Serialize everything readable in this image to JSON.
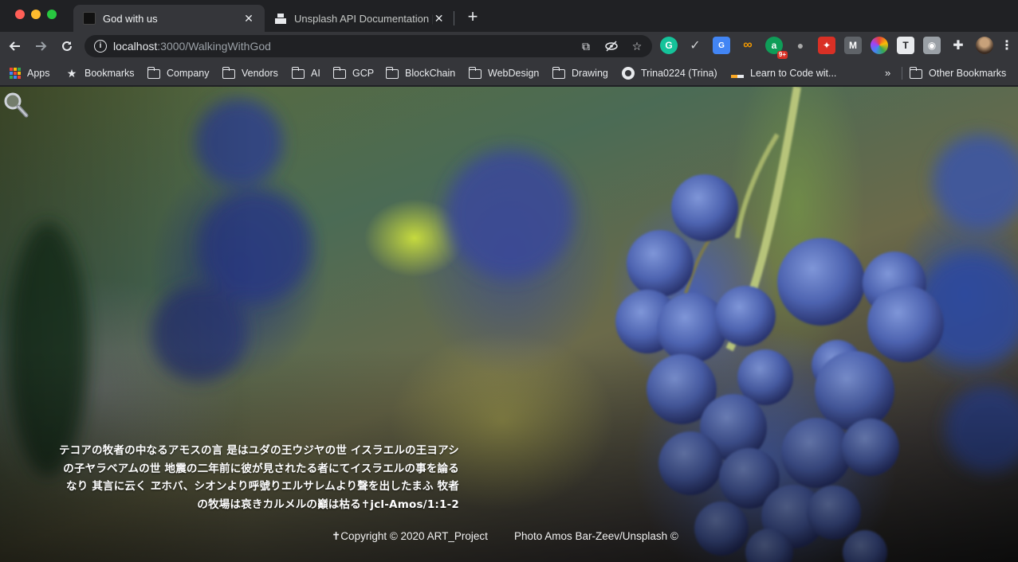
{
  "tabs": [
    {
      "title": "God with us",
      "active": true
    },
    {
      "title": "Unsplash API Documentation | F",
      "active": false
    }
  ],
  "toolbar": {
    "url_host": "localhost",
    "url_path": ":3000/WalkingWithGod",
    "extension_badge": "9+"
  },
  "bookmarks": [
    {
      "label": "Apps",
      "icon": "apps-icon"
    },
    {
      "label": "Bookmarks",
      "icon": "star-icon"
    },
    {
      "label": "Company",
      "icon": "folder-icon"
    },
    {
      "label": "Vendors",
      "icon": "folder-icon"
    },
    {
      "label": "AI",
      "icon": "folder-icon"
    },
    {
      "label": "GCP",
      "icon": "folder-icon"
    },
    {
      "label": "BlockChain",
      "icon": "folder-icon"
    },
    {
      "label": "WebDesign",
      "icon": "folder-icon"
    },
    {
      "label": "Drawing",
      "icon": "folder-icon"
    },
    {
      "label": "Trina0224 (Trina)",
      "icon": "github-icon"
    },
    {
      "label": "Learn to Code wit...",
      "icon": "learn-to-code-icon"
    },
    {
      "label": "Other Bookmarks",
      "icon": "folder-icon"
    }
  ],
  "page": {
    "verse_lines": [
      "テコアの牧者の中なるアモスの言 是はユダの王ウジヤの世 イスラエルの王ヨアシ",
      "の子ヤラベアムの世 地震の二年前に彼が見されたる者にてイスラエルの事を論る",
      "なり 其言に云く ヱホバ、シオンより呼號りエルサレムより聲を出したまふ 牧者",
      "の牧場は哀きカルメルの巓は枯る✝jcl-Amos/1:1-2"
    ],
    "copyright": "✝Copyright © 2020 ART_Project",
    "photo_credit": "Photo Amos Bar-Zeev/Unsplash ©"
  }
}
